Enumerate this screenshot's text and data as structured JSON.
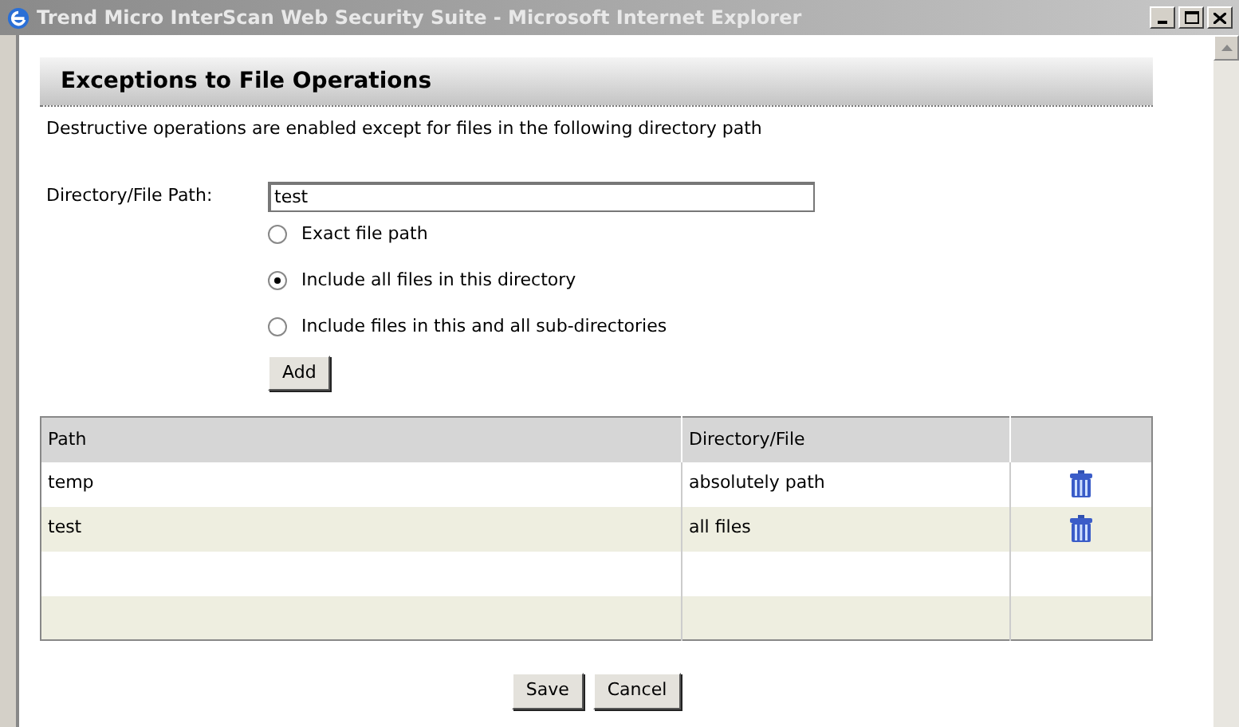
{
  "window": {
    "title": "Trend Micro InterScan Web Security Suite - Microsoft Internet Explorer"
  },
  "page": {
    "heading": "Exceptions to File Operations",
    "description": "Destructive operations are enabled except for files in the following directory path"
  },
  "path_field": {
    "label": "Directory/File Path:",
    "value": "test"
  },
  "options": [
    {
      "label": "Exact file path",
      "selected": false
    },
    {
      "label": "Include all files in this directory",
      "selected": true
    },
    {
      "label": "Include files in this and all sub-directories",
      "selected": false
    }
  ],
  "add_button": "Add",
  "table": {
    "columns": [
      "Path",
      "Directory/File"
    ],
    "rows": [
      {
        "path": "temp",
        "type": "absolutely path"
      },
      {
        "path": "test",
        "type": "all files"
      }
    ]
  },
  "buttons": [
    "Save",
    "Cancel"
  ]
}
